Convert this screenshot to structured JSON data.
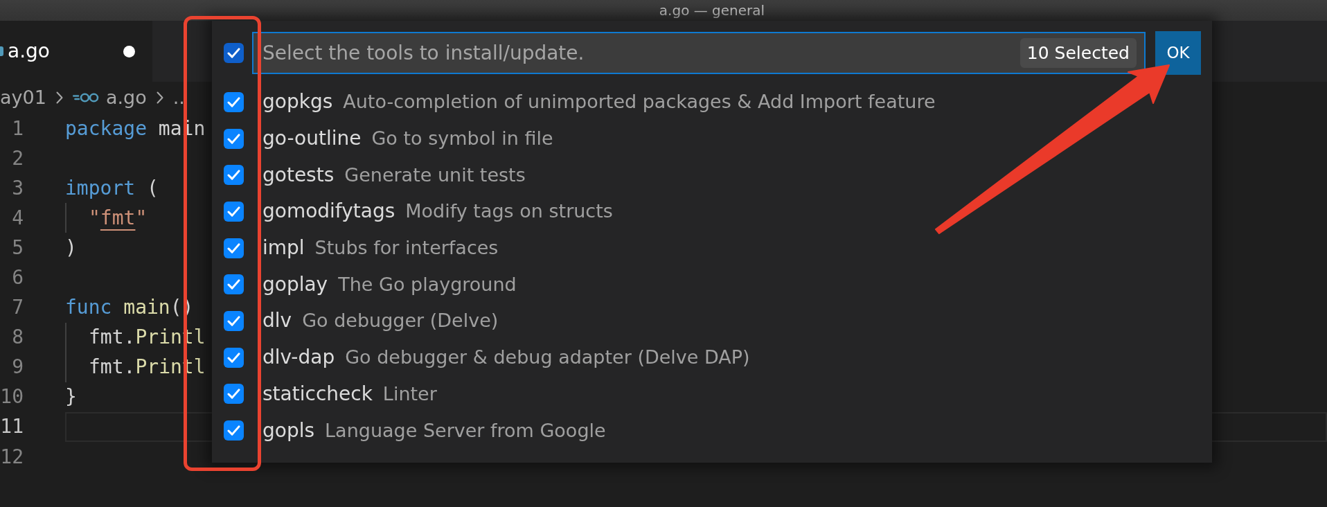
{
  "window": {
    "title": "a.go — general"
  },
  "tabs": [
    {
      "label": "a.go",
      "selected": true,
      "modified": true
    }
  ],
  "breadcrumb": [
    {
      "label": "ay01",
      "kind": "folder"
    },
    {
      "label": "a.go",
      "kind": "file"
    },
    {
      "label": "..",
      "kind": "symbol"
    }
  ],
  "editor": {
    "lines": [
      {
        "number": "1",
        "current": false,
        "indented": false,
        "tokens": [
          {
            "text": "package",
            "kind": "keyword"
          },
          {
            "text": " main",
            "kind": "plain"
          }
        ]
      },
      {
        "number": "2",
        "current": false,
        "indented": false
      },
      {
        "number": "3",
        "current": false,
        "indented": false,
        "tokens": [
          {
            "text": "import",
            "kind": "keyword"
          },
          {
            "text": " (",
            "kind": "plain"
          }
        ]
      },
      {
        "number": "4",
        "current": false,
        "indented": true,
        "tokens": [
          {
            "text": "\"",
            "kind": "string"
          },
          {
            "text": "fmt",
            "kind": "link"
          },
          {
            "text": "\"",
            "kind": "string"
          }
        ]
      },
      {
        "number": "5",
        "current": false,
        "indented": false,
        "tokens": [
          {
            "text": ")",
            "kind": "plain"
          }
        ]
      },
      {
        "number": "6",
        "current": false,
        "indented": false
      },
      {
        "number": "7",
        "current": false,
        "indented": false,
        "tokens": [
          {
            "text": "func",
            "kind": "keyword"
          },
          {
            "text": " main",
            "kind": "function"
          },
          {
            "text": "()",
            "kind": "plain"
          }
        ]
      },
      {
        "number": "8",
        "current": false,
        "indented": true,
        "tokens": [
          {
            "text": "fmt.",
            "kind": "plain"
          },
          {
            "text": "Printl",
            "kind": "function"
          }
        ]
      },
      {
        "number": "9",
        "current": false,
        "indented": true,
        "tokens": [
          {
            "text": "fmt.",
            "kind": "plain"
          },
          {
            "text": "Printl",
            "kind": "function"
          }
        ]
      },
      {
        "number": "10",
        "current": false,
        "indented": false,
        "tokens": [
          {
            "text": "}",
            "kind": "plain"
          }
        ]
      },
      {
        "number": "11",
        "current": true,
        "indented": false
      },
      {
        "number": "12",
        "current": false,
        "indented": false
      }
    ]
  },
  "quick_pick": {
    "select_all": {
      "checked": true
    },
    "input": {
      "placeholder": "Select the tools to install/update."
    },
    "count_badge": "10 Selected",
    "ok_button": "OK",
    "items": [
      {
        "label": "gopkgs",
        "description": "Auto-completion of unimported packages & Add Import feature",
        "checked": true
      },
      {
        "label": "go-outline",
        "description": "Go to symbol in file",
        "checked": true
      },
      {
        "label": "gotests",
        "description": "Generate unit tests",
        "checked": true
      },
      {
        "label": "gomodifytags",
        "description": "Modify tags on structs",
        "checked": true
      },
      {
        "label": "impl",
        "description": "Stubs for interfaces",
        "checked": true
      },
      {
        "label": "goplay",
        "description": "The Go playground",
        "checked": true
      },
      {
        "label": "dlv",
        "description": "Go debugger (Delve)",
        "checked": true
      },
      {
        "label": "dlv-dap",
        "description": "Go debugger & debug adapter (Delve DAP)",
        "checked": true
      },
      {
        "label": "staticcheck",
        "description": "Linter",
        "checked": true
      },
      {
        "label": "gopls",
        "description": "Language Server from Google",
        "checked": true
      }
    ]
  }
}
